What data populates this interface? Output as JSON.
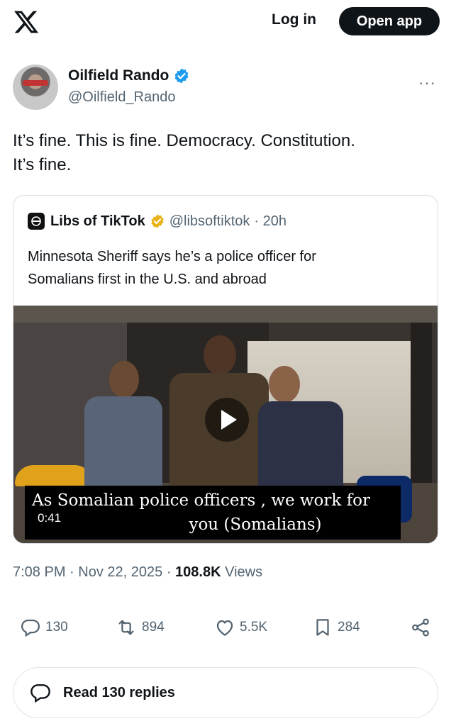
{
  "header": {
    "login_label": "Log in",
    "open_app_label": "Open app"
  },
  "post": {
    "author_name": "Oilfield Rando",
    "author_handle": "@Oilfield_Rando",
    "more_label": "···",
    "text_line1": "It’s fine. This is fine. Democracy. Constitution.",
    "text_line2": "It’s fine."
  },
  "quote": {
    "name": "Libs of TikTok",
    "handle": "@libsoftiktok",
    "time": "· 20h",
    "text_line1": "Minnesota Sheriff says he’s a police officer for",
    "text_line2": "Somalians first in the U.S. and abroad",
    "video": {
      "caption_line1": "As Somalian police officers , we work for",
      "caption_line2": "you (Somalians)",
      "duration": "0:41"
    }
  },
  "meta": {
    "time": "7:08 PM",
    "date": "Nov 22, 2025",
    "views": "108.8K",
    "views_label": "Views"
  },
  "actions": {
    "replies": "130",
    "reposts": "894",
    "likes": "5.5K",
    "bookmarks": "284"
  },
  "read_replies_label": "Read 130 replies",
  "colors": {
    "accent": "#1d9bf0",
    "gold": "#e8b318",
    "text": "#0f1419",
    "secondary": "#536471"
  }
}
